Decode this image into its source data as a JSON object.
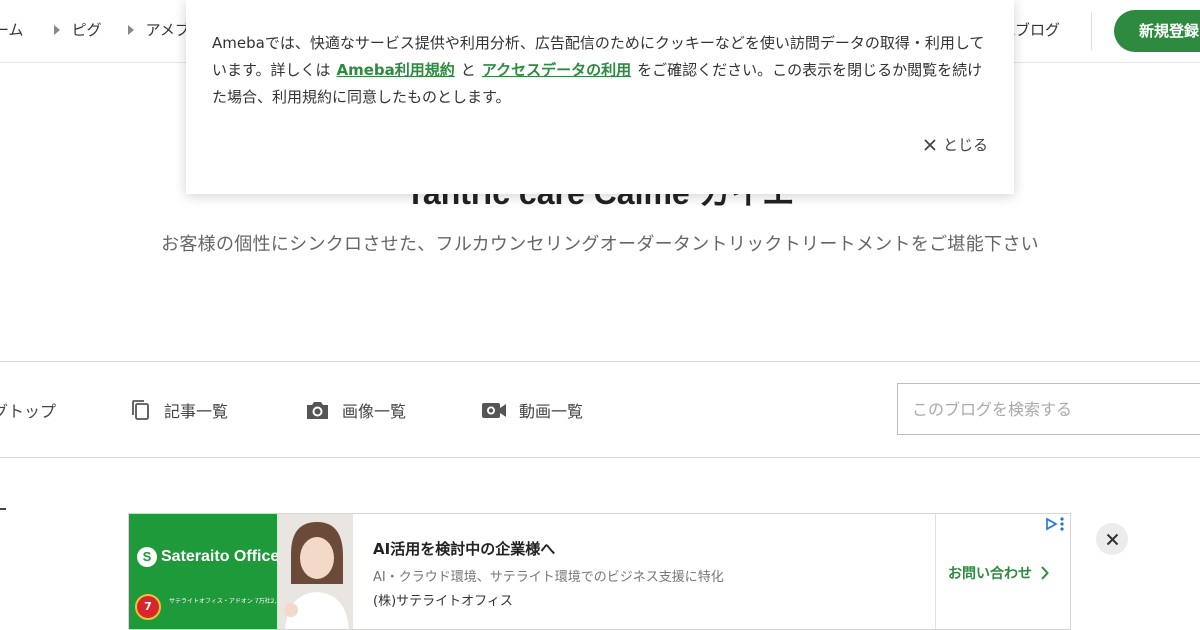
{
  "header": {
    "breadcrumbs": [
      "ーム",
      "ピグ",
      "アメブ"
    ],
    "popular_blog": "気ブログ",
    "signup_label": "新規登録"
  },
  "blog": {
    "title": "Tantric care Calme カイエ",
    "description": "お客様の個性にシンクロさせた、フルカウンセリングオーダータントリックトリートメントをご堪能下さい"
  },
  "nav": {
    "items": [
      {
        "label": "グトップ",
        "icon": "home"
      },
      {
        "label": "記事一覧",
        "icon": "articles-icon"
      },
      {
        "label": "画像一覧",
        "icon": "camera-icon"
      },
      {
        "label": "動画一覧",
        "icon": "video-icon"
      }
    ],
    "search_placeholder": "このブログを検索する"
  },
  "cookie": {
    "text_before": "Amebaでは、快適なサービス提供や利用分析、広告配信のためにクッキーなどを使い訪問データの取得・利用しています。詳しくは",
    "link_terms": "Ameba利用規約",
    "text_and": "と",
    "link_access": "アクセスデータの利用",
    "text_after": "をご確認ください。この表示を閉じるか閲覧を続けた場合、利用規約に同意したものとします。",
    "close_label": "とじる"
  },
  "ad": {
    "brand": "Sateraito Office",
    "image_caption": "サテライトオフィス・アドオン 7万社2,300万アカウント突破しました ありがとうございます!",
    "seal_text": "7",
    "title": "AI活用を検討中の企業様へ",
    "description": "AI・クラウド環境、サテライト環境でのビジネス支援に特化",
    "advertiser": "(株)サテライトオフィス",
    "cta_label": "お問い合わせ"
  },
  "colors": {
    "brand_green": "#2d8a3f",
    "ad_green": "#1f9a3a",
    "text": "#333333"
  }
}
